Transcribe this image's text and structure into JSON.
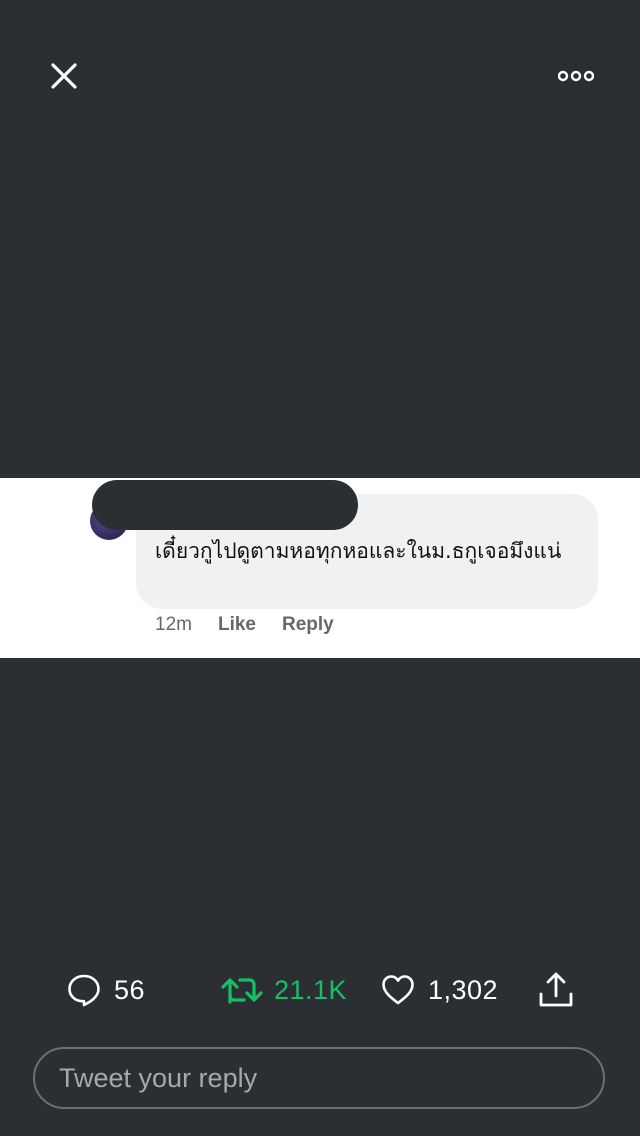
{
  "header": {
    "close_icon": "close-icon",
    "more_icon": "more-options-icon"
  },
  "embedded_comment": {
    "text": "เดี๋ยวกูไปดูตามหอทุกหอและในม.ธกูเจอมึงแน่",
    "time": "12m",
    "like_label": "Like",
    "reply_label": "Reply",
    "author_redacted": true
  },
  "actions": {
    "reply": {
      "icon": "comment-icon",
      "count": "56"
    },
    "retweet": {
      "icon": "retweet-icon",
      "count": "21.1K",
      "color": "#17bf63"
    },
    "like": {
      "icon": "heart-icon",
      "count": "1,302"
    },
    "share": {
      "icon": "share-icon"
    }
  },
  "reply_input": {
    "placeholder": "Tweet your reply",
    "value": ""
  },
  "colors": {
    "background": "#2b2f33",
    "retweet_accent": "#17bf63"
  }
}
